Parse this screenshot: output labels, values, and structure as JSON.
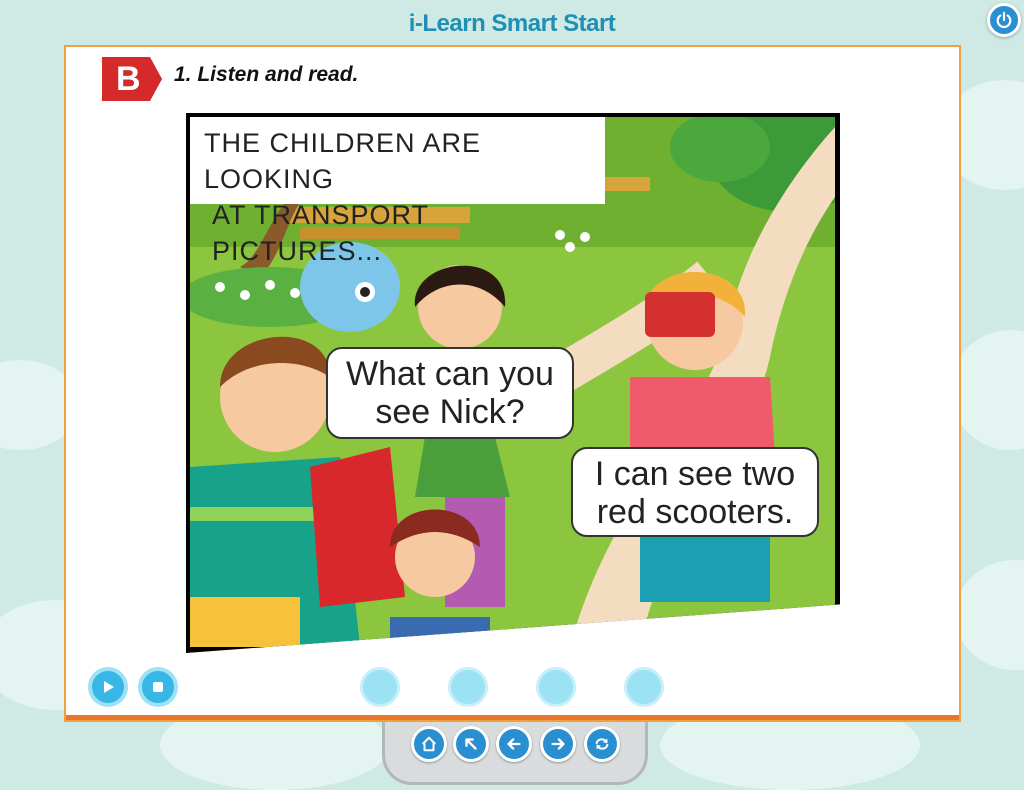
{
  "app": {
    "title": "i-Learn Smart Start"
  },
  "section": {
    "badge": "B",
    "instruction": "1. Listen and read."
  },
  "comic": {
    "caption_line1": "THE CHILDREN ARE LOOKING",
    "caption_line2": "AT TRANSPORT PICTURES...",
    "bubble1_line1": "What can you",
    "bubble1_line2": "see Nick?",
    "bubble2_line1": "I can see two",
    "bubble2_line2": "red scooters."
  },
  "player": {
    "play_icon": "play-icon",
    "stop_icon": "stop-icon",
    "page_dots": 4
  },
  "nav": {
    "icons": [
      "home-icon",
      "exit-icon",
      "back-arrow-icon",
      "forward-arrow-icon",
      "refresh-icon"
    ]
  },
  "colors": {
    "accent": "#2a8fd0",
    "badge": "#d42a2a",
    "panel_border": "#f0a040",
    "background": "#cfe9e5"
  }
}
